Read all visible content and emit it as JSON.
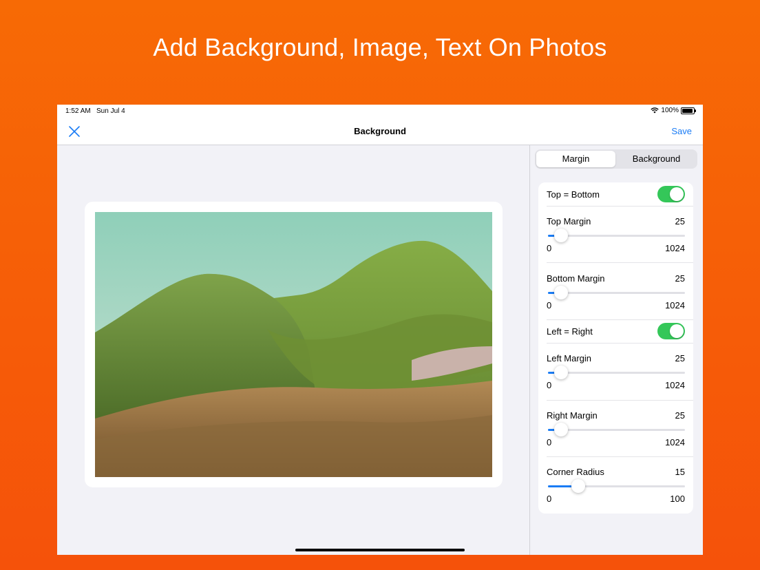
{
  "headline": "Add Background, Image, Text On Photos",
  "status": {
    "time": "1:52 AM",
    "date": "Sun Jul 4",
    "battery": "100%"
  },
  "nav": {
    "title": "Background",
    "save_label": "Save",
    "close_icon": "close-icon"
  },
  "tabs": [
    {
      "label": "Margin",
      "active": true
    },
    {
      "label": "Background",
      "active": false
    }
  ],
  "settings": {
    "top_eq_bottom": {
      "label": "Top = Bottom",
      "on": true
    },
    "top_margin": {
      "label": "Top Margin",
      "value": "25",
      "min": "0",
      "max": "1024",
      "level": 0.0244
    },
    "bottom_margin": {
      "label": "Bottom Margin",
      "value": "25",
      "min": "0",
      "max": "1024",
      "level": 0.0244
    },
    "left_eq_right": {
      "label": "Left = Right",
      "on": true
    },
    "left_margin": {
      "label": "Left Margin",
      "value": "25",
      "min": "0",
      "max": "1024",
      "level": 0.0244
    },
    "right_margin": {
      "label": "Right Margin",
      "value": "25",
      "min": "0",
      "max": "1024",
      "level": 0.0244
    },
    "corner_radius": {
      "label": "Corner Radius",
      "value": "15",
      "min": "0",
      "max": "100",
      "level": 0.15
    }
  },
  "colors": {
    "accent": "#1a7cf5",
    "toggle_on": "#34c759",
    "background_orange": "#f76a05"
  }
}
